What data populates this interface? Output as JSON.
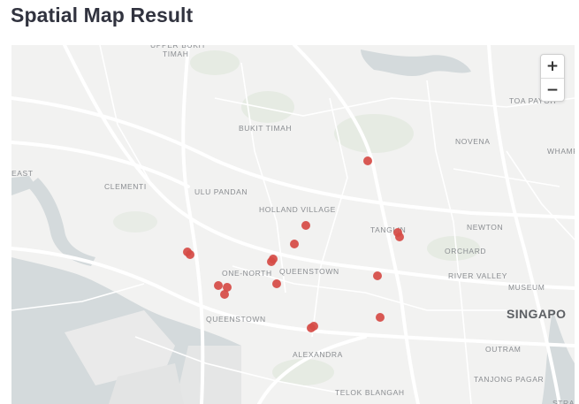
{
  "page": {
    "title": "Spatial Map Result"
  },
  "map": {
    "zoom_in_label": "+",
    "zoom_out_label": "−",
    "marker_color": "#d64b45",
    "place_labels": [
      {
        "text": "UPPER BUKIT",
        "cls": ""
      },
      {
        "text": "TIMAH",
        "cls": ""
      },
      {
        "text": "TOA PAYOH",
        "cls": ""
      },
      {
        "text": "BUKIT TIMAH",
        "cls": ""
      },
      {
        "text": "NOVENA",
        "cls": ""
      },
      {
        "text": "WHAMP",
        "cls": ""
      },
      {
        "text": "EAST",
        "cls": ""
      },
      {
        "text": "CLEMENTI",
        "cls": ""
      },
      {
        "text": "ULU PANDAN",
        "cls": ""
      },
      {
        "text": "HOLLAND VILLAGE",
        "cls": ""
      },
      {
        "text": "TANGLIN",
        "cls": ""
      },
      {
        "text": "NEWTON",
        "cls": ""
      },
      {
        "text": "ORCHARD",
        "cls": ""
      },
      {
        "text": "ONE-NORTH",
        "cls": ""
      },
      {
        "text": "QUEENSTOWN",
        "cls": ""
      },
      {
        "text": "RIVER VALLEY",
        "cls": ""
      },
      {
        "text": "MUSEUM",
        "cls": ""
      },
      {
        "text": "SINGAPO",
        "cls": "big"
      },
      {
        "text": "QUEENSTOWN",
        "cls": ""
      },
      {
        "text": "OUTRAM",
        "cls": ""
      },
      {
        "text": "ALEXANDRA",
        "cls": ""
      },
      {
        "text": "TANJONG PAGAR",
        "cls": ""
      },
      {
        "text": "TELOK BLANGAH",
        "cls": ""
      },
      {
        "text": "STRAI",
        "cls": ""
      }
    ],
    "marker_count": 20
  }
}
